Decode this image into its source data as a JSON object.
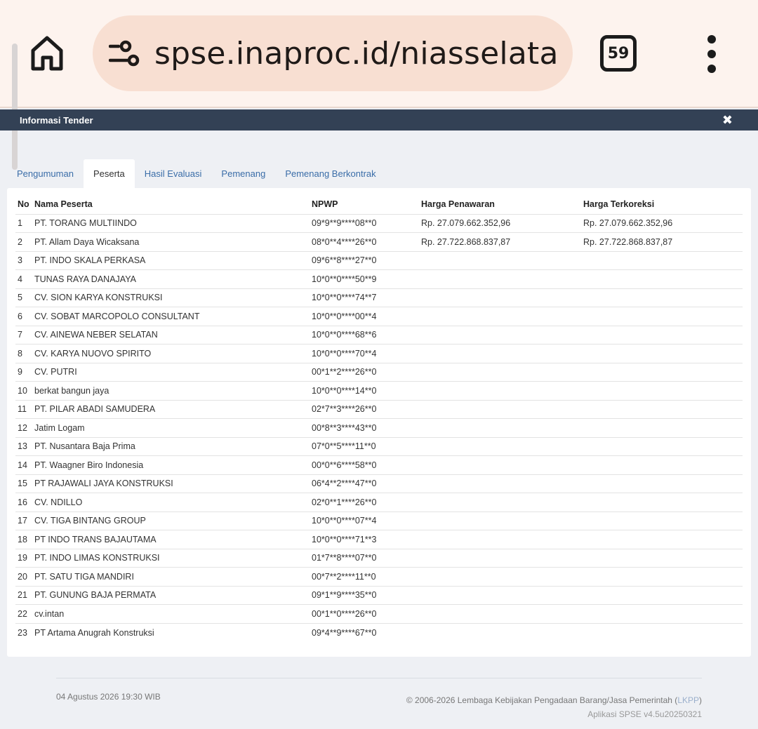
{
  "browser": {
    "url": "spse.inaproc.id/niasselatanka",
    "tab_count": "59",
    "icons": {
      "home": "home-icon",
      "site_info": "tune-icon",
      "menu": "more-vert-icon"
    }
  },
  "modal": {
    "title": "Informasi Tender",
    "close_icon": "close-icon"
  },
  "tabs": [
    {
      "label": "Pengumuman",
      "active": false
    },
    {
      "label": "Peserta",
      "active": true
    },
    {
      "label": "Hasil Evaluasi",
      "active": false
    },
    {
      "label": "Pemenang",
      "active": false
    },
    {
      "label": "Pemenang Berkontrak",
      "active": false
    }
  ],
  "table": {
    "headers": {
      "no": "No",
      "nama": "Nama Peserta",
      "npwp": "NPWP",
      "harga_penawaran": "Harga Penawaran",
      "harga_terkoreksi": "Harga Terkoreksi"
    },
    "rows": [
      {
        "no": "1",
        "nama": "PT. TORANG MULTIINDO",
        "npwp": "09*9**9****08**0",
        "harga_penawaran": "Rp. 27.079.662.352,96",
        "harga_terkoreksi": "Rp. 27.079.662.352,96"
      },
      {
        "no": "2",
        "nama": "PT. Allam Daya Wicaksana",
        "npwp": "08*0**4****26**0",
        "harga_penawaran": "Rp. 27.722.868.837,87",
        "harga_terkoreksi": "Rp. 27.722.868.837,87"
      },
      {
        "no": "3",
        "nama": "PT. INDO SKALA PERKASA",
        "npwp": "09*6**8****27**0",
        "harga_penawaran": "",
        "harga_terkoreksi": ""
      },
      {
        "no": "4",
        "nama": "TUNAS RAYA DANAJAYA",
        "npwp": "10*0**0****50**9",
        "harga_penawaran": "",
        "harga_terkoreksi": ""
      },
      {
        "no": "5",
        "nama": "CV. SION KARYA KONSTRUKSI",
        "npwp": "10*0**0****74**7",
        "harga_penawaran": "",
        "harga_terkoreksi": ""
      },
      {
        "no": "6",
        "nama": "CV. SOBAT MARCOPOLO CONSULTANT",
        "npwp": "10*0**0****00**4",
        "harga_penawaran": "",
        "harga_terkoreksi": ""
      },
      {
        "no": "7",
        "nama": "CV. AINEWA NEBER SELATAN",
        "npwp": "10*0**0****68**6",
        "harga_penawaran": "",
        "harga_terkoreksi": ""
      },
      {
        "no": "8",
        "nama": "CV. KARYA NUOVO SPIRITO",
        "npwp": "10*0**0****70**4",
        "harga_penawaran": "",
        "harga_terkoreksi": ""
      },
      {
        "no": "9",
        "nama": "CV. PUTRI",
        "npwp": "00*1**2****26**0",
        "harga_penawaran": "",
        "harga_terkoreksi": ""
      },
      {
        "no": "10",
        "nama": "berkat bangun jaya",
        "npwp": "10*0**0****14**0",
        "harga_penawaran": "",
        "harga_terkoreksi": ""
      },
      {
        "no": "11",
        "nama": "PT. PILAR ABADI SAMUDERA",
        "npwp": "02*7**3****26**0",
        "harga_penawaran": "",
        "harga_terkoreksi": ""
      },
      {
        "no": "12",
        "nama": "Jatim Logam",
        "npwp": "00*8**3****43**0",
        "harga_penawaran": "",
        "harga_terkoreksi": ""
      },
      {
        "no": "13",
        "nama": "PT. Nusantara Baja Prima",
        "npwp": "07*0**5****11**0",
        "harga_penawaran": "",
        "harga_terkoreksi": ""
      },
      {
        "no": "14",
        "nama": "PT. Waagner Biro Indonesia",
        "npwp": "00*0**6****58**0",
        "harga_penawaran": "",
        "harga_terkoreksi": ""
      },
      {
        "no": "15",
        "nama": "PT RAJAWALI JAYA KONSTRUKSI",
        "npwp": "06*4**2****47**0",
        "harga_penawaran": "",
        "harga_terkoreksi": ""
      },
      {
        "no": "16",
        "nama": "CV. NDILLO",
        "npwp": "02*0**1****26**0",
        "harga_penawaran": "",
        "harga_terkoreksi": ""
      },
      {
        "no": "17",
        "nama": "CV. TIGA BINTANG GROUP",
        "npwp": "10*0**0****07**4",
        "harga_penawaran": "",
        "harga_terkoreksi": ""
      },
      {
        "no": "18",
        "nama": "PT INDO TRANS BAJAUTAMA",
        "npwp": "10*0**0****71**3",
        "harga_penawaran": "",
        "harga_terkoreksi": ""
      },
      {
        "no": "19",
        "nama": "PT. INDO LIMAS KONSTRUKSI",
        "npwp": "01*7**8****07**0",
        "harga_penawaran": "",
        "harga_terkoreksi": ""
      },
      {
        "no": "20",
        "nama": "PT. SATU TIGA MANDIRI",
        "npwp": "00*7**2****11**0",
        "harga_penawaran": "",
        "harga_terkoreksi": ""
      },
      {
        "no": "21",
        "nama": "PT. GUNUNG BAJA PERMATA",
        "npwp": "09*1**9****35**0",
        "harga_penawaran": "",
        "harga_terkoreksi": ""
      },
      {
        "no": "22",
        "nama": "cv.intan",
        "npwp": "00*1**0****26**0",
        "harga_penawaran": "",
        "harga_terkoreksi": ""
      },
      {
        "no": "23",
        "nama": "PT Artama Anugrah Konstruksi",
        "npwp": "09*4**9****67**0",
        "harga_penawaran": "",
        "harga_terkoreksi": ""
      }
    ]
  },
  "footer": {
    "timestamp": "04 Agustus 2026 19:30 WIB",
    "copyright_prefix": "© 2006-2026 Lembaga Kebijakan Pengadaan Barang/Jasa Pemerintah (",
    "lkpp": "LKPP",
    "copyright_suffix": ")",
    "version": "Aplikasi SPSE v4.5u20250321"
  },
  "colors": {
    "header_bg": "#334155",
    "link": "#3a6da8",
    "browser_bg": "#fdf3ee",
    "urlbar_bg": "#f8dfd2"
  }
}
